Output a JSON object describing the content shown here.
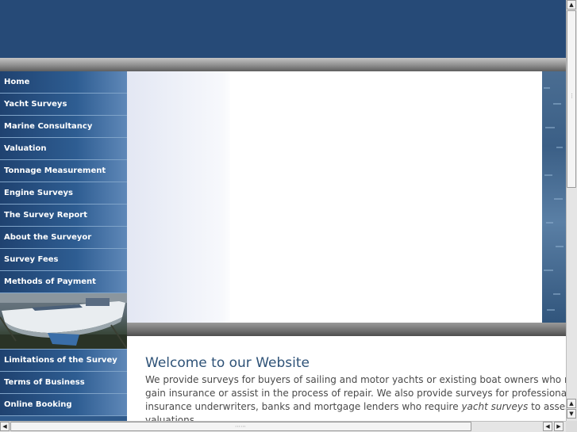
{
  "nav": {
    "top_items": [
      {
        "label": "Home"
      },
      {
        "label": "Yacht Surveys"
      },
      {
        "label": "Marine Consultancy"
      },
      {
        "label": "Valuation"
      },
      {
        "label": "Tonnage Measurement"
      },
      {
        "label": "Engine Surveys"
      },
      {
        "label": "The Survey Report"
      },
      {
        "label": "About the Surveyor"
      },
      {
        "label": "Survey Fees"
      },
      {
        "label": "Methods of Payment"
      }
    ],
    "bottom_items": [
      {
        "label": "Limitations of the Survey"
      },
      {
        "label": "Terms of Business"
      },
      {
        "label": "Online Booking"
      }
    ]
  },
  "content": {
    "heading": "Welcome to our Website",
    "para_line1": "We provide surveys for buyers of sailing and motor yachts or existing boat owners who requi",
    "para_line2": "gain insurance or assist in the process of repair. We also provide surveys for professional bo",
    "para_line3_start": "insurance underwriters, banks and mortgage lenders who require ",
    "para_line3_em": "yacht surveys",
    "para_line3_end": " to assess th",
    "para_line4": "valuations"
  },
  "colors": {
    "header": "#264a77",
    "nav_text": "#ffffff",
    "heading": "#2e5277"
  },
  "icons": {
    "scroll_up": "▲",
    "scroll_down": "▼",
    "scroll_left": "◀",
    "scroll_right": "▶"
  }
}
